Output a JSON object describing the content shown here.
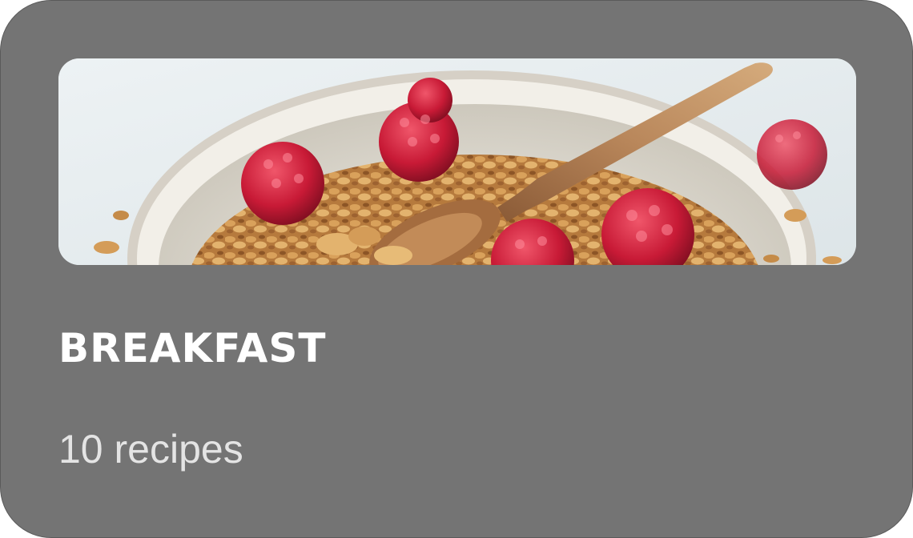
{
  "card": {
    "title": "BREAKFAST",
    "count_label": "10 recipes",
    "image": {
      "subject": "granola-bowl-with-raspberries-and-wooden-spoon"
    }
  },
  "colors": {
    "card_background": "#747474",
    "title_text": "#ffffff",
    "subtitle_text": "#e4e4e4"
  }
}
